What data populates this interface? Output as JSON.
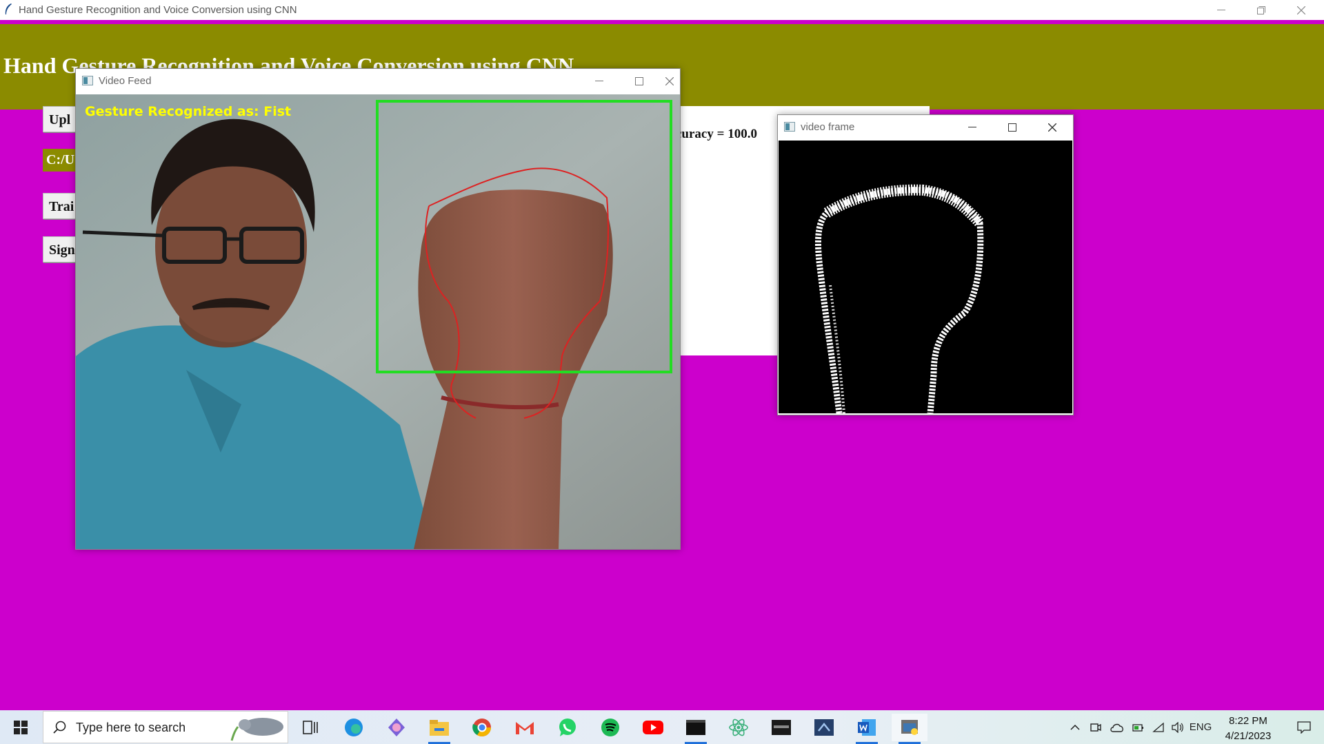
{
  "app": {
    "title": "Hand Gesture Recognition and Voice Conversion using CNN",
    "header": "Hand Gesture Recognition and Voice Conversion using CNN",
    "buttons": [
      {
        "label": "Upl"
      },
      {
        "label": "Trai"
      },
      {
        "label": "Sign"
      }
    ],
    "path_label": "C:/U",
    "result_text": "curacy = 100.0"
  },
  "video_feed": {
    "title": "Video Feed",
    "gesture_overlay": "Gesture Recognized as: Fist"
  },
  "video_frame": {
    "title": "video frame"
  },
  "taskbar": {
    "search_placeholder": "Type here to search",
    "language": "ENG",
    "time": "8:22 PM",
    "date": "4/21/2023",
    "apps": [
      "task-view",
      "edge",
      "copilot",
      "file-explorer",
      "chrome",
      "gmail",
      "whatsapp",
      "spotify",
      "youtube",
      "terminal",
      "react",
      "mysql",
      "visual-studio",
      "word",
      "python"
    ]
  },
  "colors": {
    "background": "#cc00cc",
    "header": "#8b8b00",
    "roi_box": "#22dd22",
    "contour": "#dd2222",
    "overlay_text": "#ffff00"
  }
}
